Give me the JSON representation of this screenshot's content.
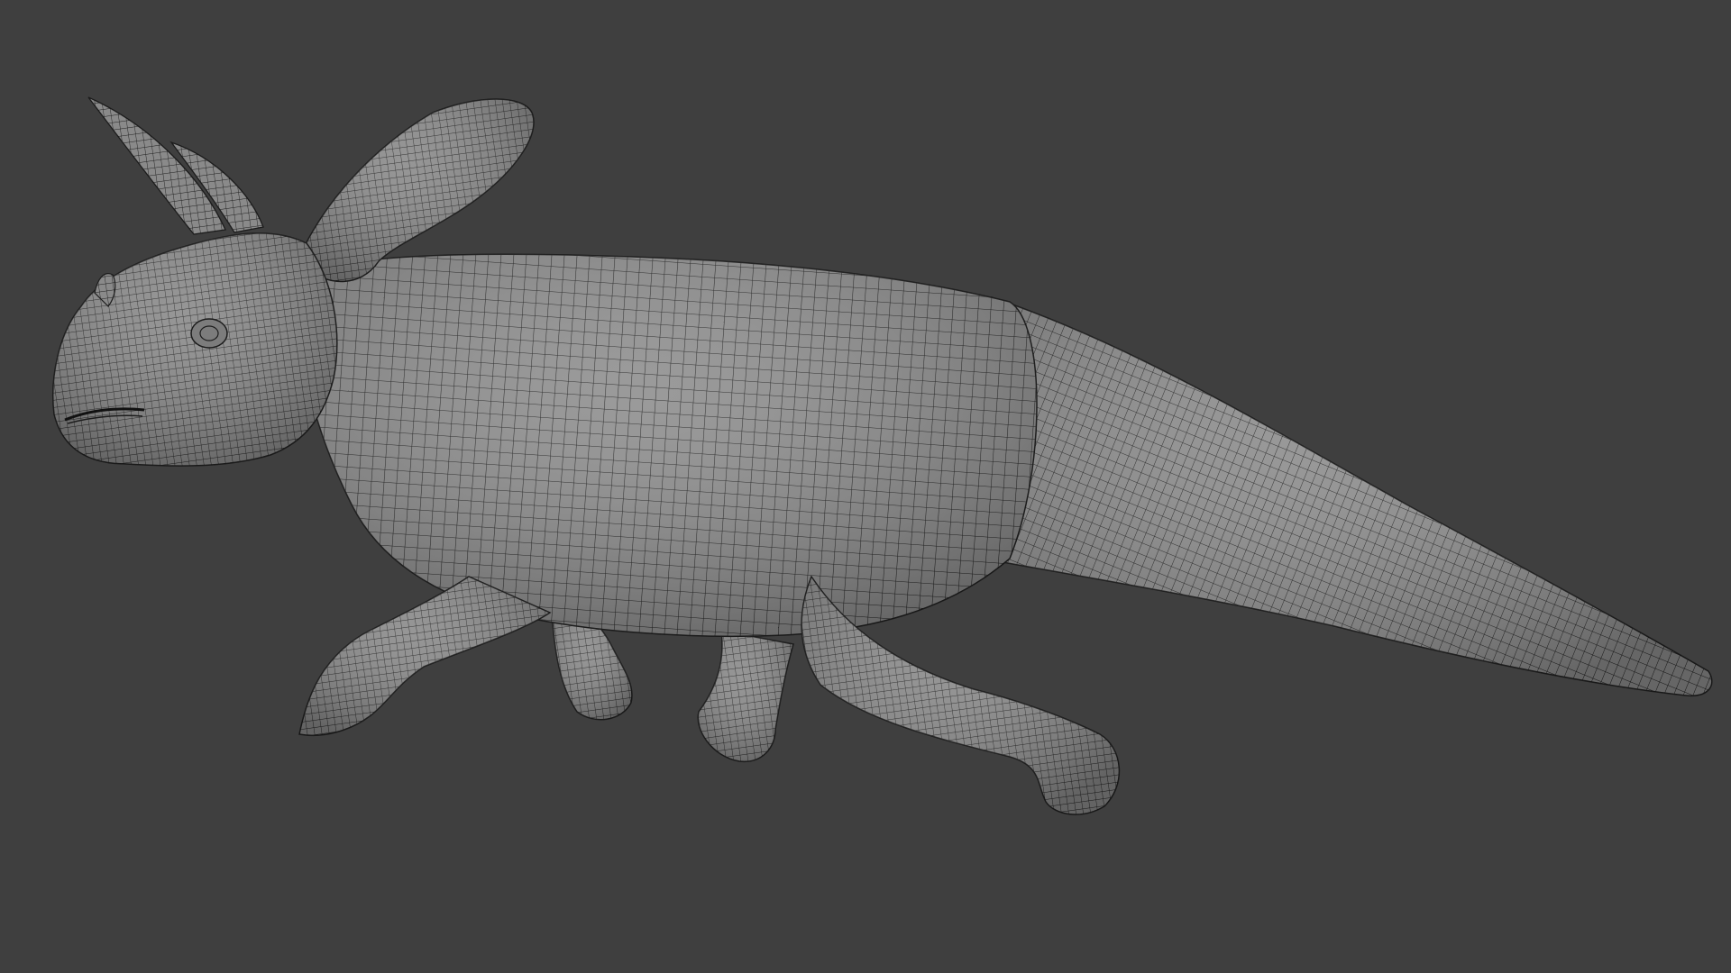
{
  "viewport": {
    "background_color": "#3f3f3f",
    "mesh_fill_color": "#8c8c8c",
    "mesh_shade_color": "#6e6e6e",
    "wire_color": "#1c1c1c",
    "subject": "ceratopsian-dinosaur-wireframe-mesh"
  }
}
